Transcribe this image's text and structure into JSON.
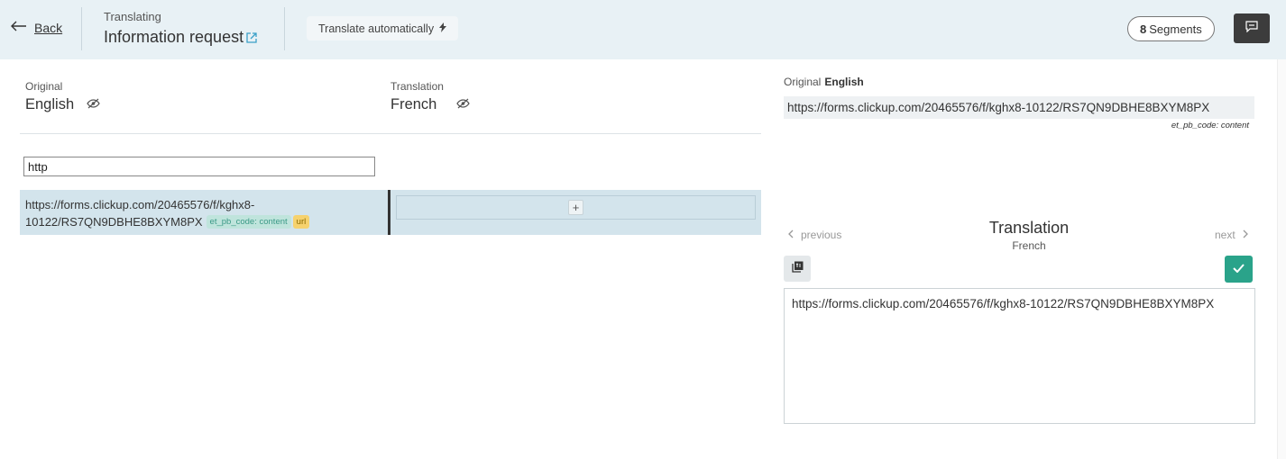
{
  "header": {
    "back_label": "Back",
    "translating_label": "Translating",
    "title": "Information request",
    "auto_translate_label": "Translate automatically",
    "segments_count": "8",
    "segments_label": "Segments"
  },
  "left": {
    "original_label": "Original",
    "original_lang": "English",
    "translation_label": "Translation",
    "translation_lang": "French",
    "search_value": "http",
    "rows": [
      {
        "source": "https://forms.clickup.com/20465576/f/kghx8-10122/RS7QN9DBHE8BXYM8PX",
        "tag_code": "et_pb_code: content",
        "tag_url": "url",
        "add_label": "+"
      }
    ]
  },
  "right": {
    "original_label": "Original",
    "original_lang": "English",
    "original_text": "https://forms.clickup.com/20465576/f/kghx8-10122/RS7QN9DBHE8BXYM8PX",
    "original_note": "et_pb_code: content",
    "previous_label": "previous",
    "next_label": "next",
    "translation_title": "Translation",
    "translation_lang": "French",
    "translation_text": "https://forms.clickup.com/20465576/f/kghx8-10122/RS7QN9DBHE8BXYM8PX"
  },
  "icons": {
    "back": "arrow-left-icon",
    "external": "external-link-icon",
    "bolt": "lightning-icon",
    "comment": "comment-icon",
    "visibility": "eye-slash-icon",
    "copy": "copy-icon",
    "confirm": "check-icon"
  },
  "colors": {
    "header_bg": "#e8f1f5",
    "row_bg": "#d3e4ec",
    "confirm": "#2aa38a",
    "tag_code": "#bfe4dc",
    "tag_url": "#f6d26e",
    "dark_button": "#3c3c3c"
  }
}
